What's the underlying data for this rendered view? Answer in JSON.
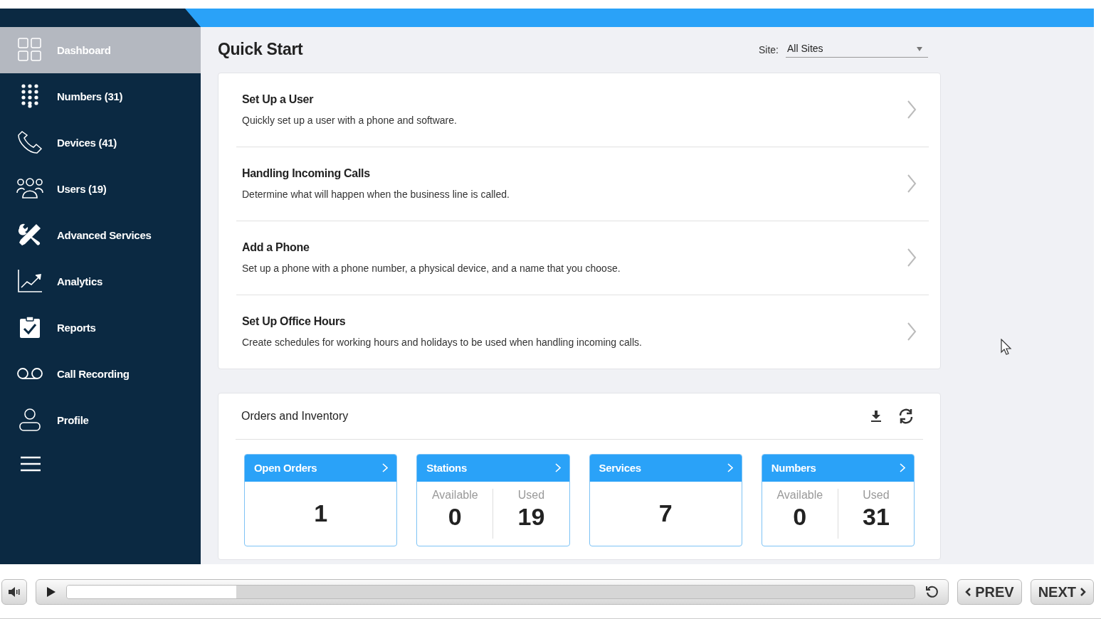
{
  "sidebar": {
    "items": [
      {
        "label": "Dashboard",
        "selected": true
      },
      {
        "label": "Numbers (31)",
        "selected": false
      },
      {
        "label": "Devices (41)",
        "selected": false
      },
      {
        "label": "Users (19)",
        "selected": false
      },
      {
        "label": "Advanced Services",
        "selected": false
      },
      {
        "label": "Analytics",
        "selected": false
      },
      {
        "label": "Reports",
        "selected": false
      },
      {
        "label": "Call Recording",
        "selected": false
      },
      {
        "label": "Profile",
        "selected": false
      }
    ]
  },
  "page_title": "Quick Start",
  "site_filter": {
    "label": "Site:",
    "value": "All Sites"
  },
  "quick_start": [
    {
      "title": "Set Up a User",
      "description": "Quickly set up a user with a phone and software."
    },
    {
      "title": "Handling Incoming Calls",
      "description": "Determine what will happen when the business line is called."
    },
    {
      "title": "Add a Phone",
      "description": "Set up a phone with a phone number, a physical device, and a name that you choose."
    },
    {
      "title": "Set Up Office Hours",
      "description": "Create schedules for working hours and holidays to be used when handling incoming calls."
    }
  ],
  "orders": {
    "title": "Orders and Inventory",
    "tiles": [
      {
        "kind": "single",
        "title": "Open Orders",
        "value": "1"
      },
      {
        "kind": "split",
        "title": "Stations",
        "left_label": "Available",
        "left_value": "0",
        "right_label": "Used",
        "right_value": "19"
      },
      {
        "kind": "single",
        "title": "Services",
        "value": "7"
      },
      {
        "kind": "split",
        "title": "Numbers",
        "left_label": "Available",
        "left_value": "0",
        "right_label": "Used",
        "right_value": "31"
      }
    ]
  },
  "player": {
    "level": 0.2,
    "prev": "PREV",
    "next": "NEXT"
  }
}
